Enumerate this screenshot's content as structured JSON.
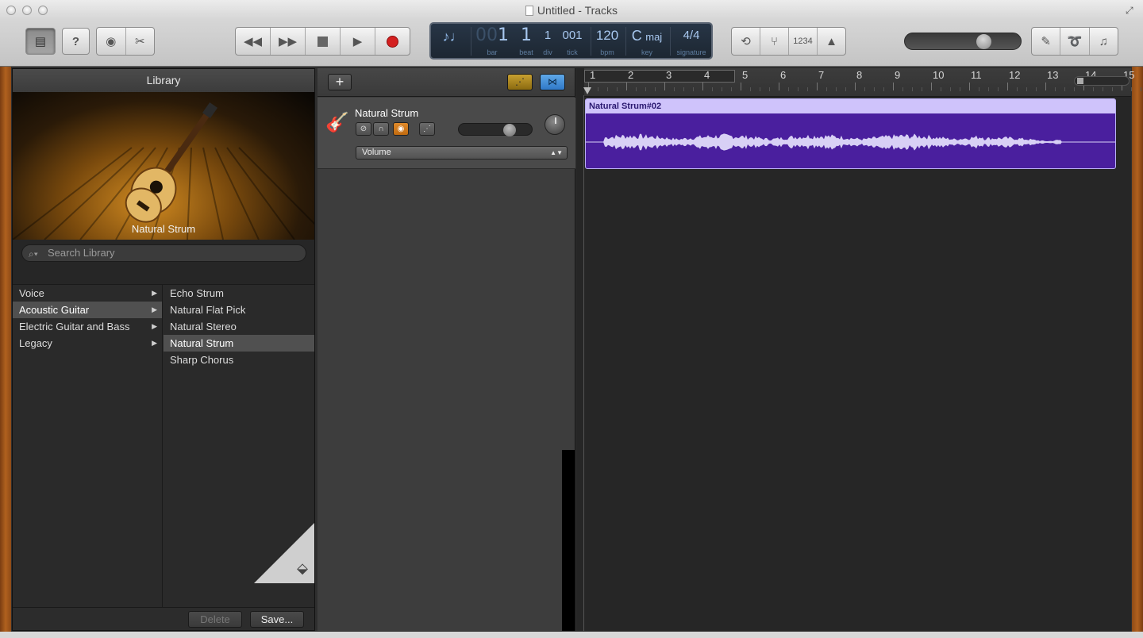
{
  "window": {
    "title": "Untitled - Tracks"
  },
  "toolbar": {
    "count_in": "1234"
  },
  "lcd": {
    "bar": {
      "dim": "00",
      "value": "1",
      "label": "bar"
    },
    "beat": {
      "value": "1",
      "label": "beat"
    },
    "div": {
      "value": "1",
      "label": "div"
    },
    "tick": {
      "dim": "00",
      "value": "1",
      "label": "tick"
    },
    "bpm": {
      "value": "120",
      "label": "bpm"
    },
    "key": {
      "value": "C",
      "mode": "maj",
      "label": "key"
    },
    "signature": {
      "num": "4",
      "den": "4",
      "label": "signature"
    }
  },
  "library": {
    "title": "Library",
    "hero_name": "Natural Strum",
    "search_placeholder": "Search Library",
    "categories": [
      {
        "label": "Voice",
        "selected": false
      },
      {
        "label": "Acoustic Guitar",
        "selected": true
      },
      {
        "label": "Electric Guitar and Bass",
        "selected": false
      },
      {
        "label": "Legacy",
        "selected": false
      }
    ],
    "patches": [
      {
        "label": "Echo Strum",
        "selected": false
      },
      {
        "label": "Natural Flat Pick",
        "selected": false
      },
      {
        "label": "Natural Stereo",
        "selected": false
      },
      {
        "label": "Natural Strum",
        "selected": true
      },
      {
        "label": "Sharp Chorus",
        "selected": false
      }
    ],
    "delete_label": "Delete",
    "save_label": "Save..."
  },
  "track": {
    "name": "Natural Strum",
    "automation": "Volume"
  },
  "ruler": {
    "bars": [
      "1",
      "2",
      "3",
      "4",
      "5",
      "6",
      "7",
      "8",
      "9",
      "10",
      "11",
      "12",
      "13",
      "14",
      "15"
    ]
  },
  "region": {
    "name": "Natural Strum#02"
  },
  "colors": {
    "region_body": "#4a1f9e",
    "region_header": "#cfc3fb",
    "lcd_bg": "#1d2732",
    "record": "#d42020",
    "solo": "#e08a2a"
  }
}
